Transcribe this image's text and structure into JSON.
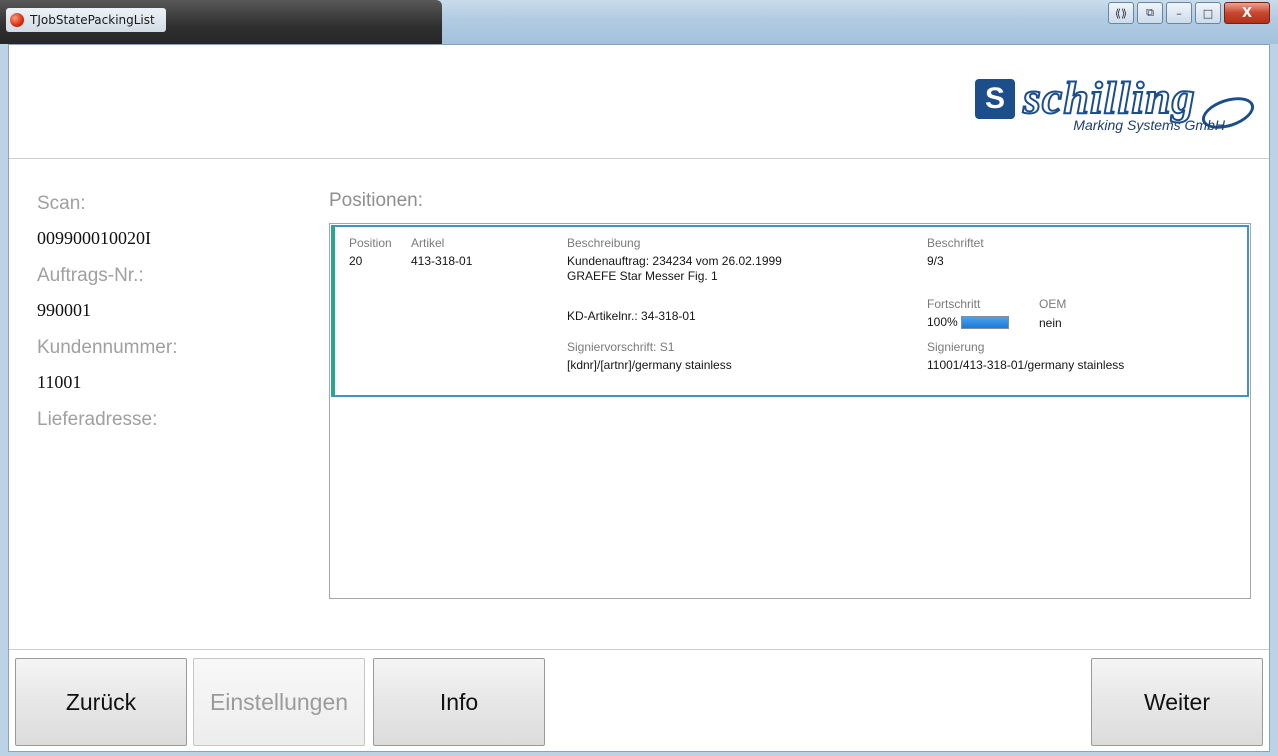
{
  "window": {
    "title": "TJobStatePackingList",
    "caption_buttons": {
      "nav": "⟪⟫",
      "restore": "⧉",
      "minimize": "–",
      "maximize": "□",
      "close": "X"
    }
  },
  "logo": {
    "word": "schilling",
    "subtitle": "Marking Systems GmbH",
    "mark": "S"
  },
  "left_panel": {
    "scan_label": "Scan:",
    "scan_value": "009900010020I",
    "order_label": "Auftrags-Nr.:",
    "order_value": "990001",
    "customer_label": "Kundennummer:",
    "customer_value": "11001",
    "delivery_label": "Lieferadresse:"
  },
  "positions": {
    "label": "Positionen:",
    "rows": [
      {
        "position_hdr": "Position",
        "position": "20",
        "article_hdr": "Artikel",
        "article": "413-318-01",
        "description_hdr": "Beschreibung",
        "description_line1": "Kundenauftrag: 234234 vom 26.02.1999",
        "description_line2": "GRAEFE Star Messer Fig. 1",
        "customer_article": "KD-Artikelnr.: 34-318-01",
        "signing_rule_hdr": "Signiervorschrift: S1",
        "signing_rule": "[kdnr]/[artnr]/germany stainless",
        "labeled_hdr": "Beschriftet",
        "labeled": "9/3",
        "progress_hdr": "Fortschritt",
        "progress_text": "100%",
        "progress_value": 1.0,
        "oem_hdr": "OEM",
        "oem": "nein",
        "signing_hdr": "Signierung",
        "signing": "11001/413-318-01/germany stainless"
      }
    ]
  },
  "footer": {
    "back_label": "Zurück",
    "settings_label": "Einstellungen",
    "info_label": "Info",
    "next_label": "Weiter"
  },
  "colors": {
    "accent_border": "#3e93c9",
    "row_marker": "#2aa58e",
    "progress_fill": "#1f79d6",
    "brand": "#1d4e8c"
  }
}
